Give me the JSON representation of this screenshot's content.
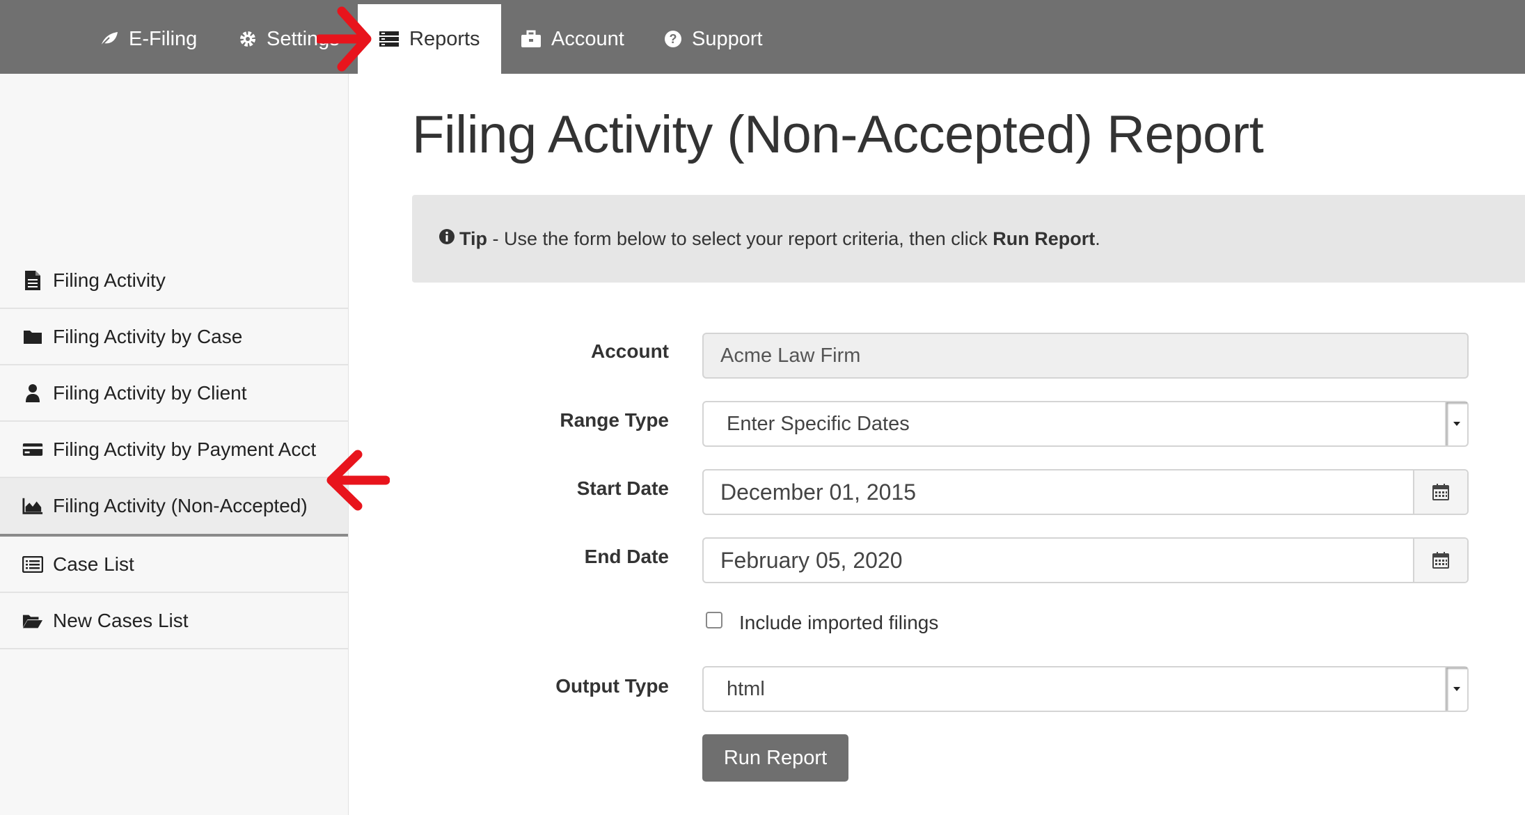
{
  "nav": {
    "items": [
      {
        "label": "E-Filing",
        "icon": "leaf-icon"
      },
      {
        "label": "Settings",
        "icon": "gear-icon"
      },
      {
        "label": "Reports",
        "icon": "server-icon",
        "active": true
      },
      {
        "label": "Account",
        "icon": "briefcase-icon"
      },
      {
        "label": "Support",
        "icon": "question-circle-icon"
      }
    ]
  },
  "sidebar": {
    "items": [
      {
        "label": "Filing Activity",
        "icon": "file-icon"
      },
      {
        "label": "Filing Activity by Case",
        "icon": "folder-icon"
      },
      {
        "label": "Filing Activity by Client",
        "icon": "user-icon"
      },
      {
        "label": "Filing Activity by Payment Acct",
        "icon": "credit-card-icon"
      },
      {
        "label": "Filing Activity (Non-Accepted)",
        "icon": "area-chart-icon",
        "active": true
      },
      {
        "label": "Case List",
        "icon": "list-icon"
      },
      {
        "label": "New Cases List",
        "icon": "folder-open-icon"
      }
    ]
  },
  "main": {
    "title": "Filing Activity (Non-Accepted) Report",
    "tip": {
      "lead": "Tip",
      "text": " - Use the form below to select your report criteria, then click ",
      "action": "Run Report",
      "end": "."
    },
    "form": {
      "account_label": "Account",
      "account_value": "Acme Law Firm",
      "range_label": "Range Type",
      "range_value": "Enter Specific Dates",
      "start_label": "Start Date",
      "start_value": "December 01, 2015",
      "end_label": "End Date",
      "end_value": "February 05, 2020",
      "include_label": "Include imported filings",
      "include_checked": false,
      "output_label": "Output Type",
      "output_value": "html",
      "run_label": "Run Report"
    }
  },
  "colors": {
    "nav_bg": "#707070",
    "annotation_arrow": "#e8141c",
    "button_bg": "#6f6f6f"
  }
}
